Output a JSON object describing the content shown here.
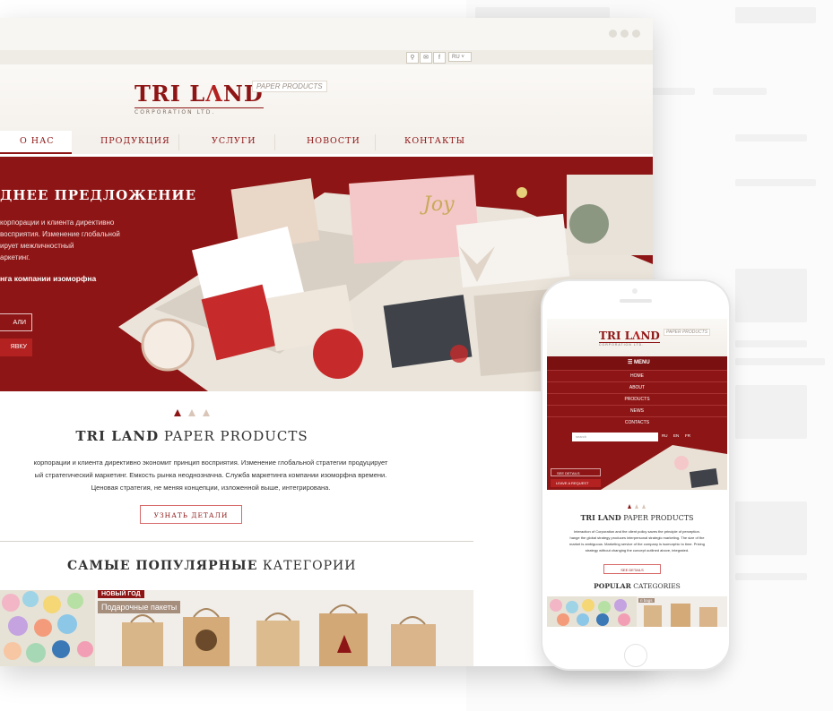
{
  "desktop": {
    "topbar": {
      "lang": "RU"
    },
    "logo": {
      "name_part1": "TRI L",
      "name_part2": "ND",
      "subtitle": "CORPORATION LTD.",
      "tag": "PAPER PRODUCTS"
    },
    "nav": [
      "О НАС",
      "ПРОДУКЦИЯ",
      "УСЛУГИ",
      "НОВОСТИ",
      "КОНТАКТЫ"
    ],
    "hero": {
      "title": "ДНЕЕ ПРЕДЛОЖЕНИЕ",
      "lines": [
        "корпорации и клиента директивно",
        "восприятия. Изменение глобальной",
        "ирует межличностный",
        "аркетинг."
      ],
      "strong": "нга компании изоморфна",
      "btn_details": "АЛИ",
      "btn_request": "ЯВКУ"
    },
    "about": {
      "title_bold": "TRI LAND",
      "title_rest": "PAPER PRODUCTS",
      "lines": [
        "корпорации и клиента директивно экономит принцип восприятия. Изменение глобальной стратегии продуцирует",
        "ый стратегический маркетинг. Емкость рынка неоднозначна. Служба маркетинга компании изоморфна времени.",
        "Ценовая стратегия, не меняя концепции, изложенной выше, интегрирована."
      ],
      "button": "УЗНАТЬ ДЕТАЛИ"
    },
    "popular": {
      "title_bold": "САМЫЕ ПОПУЛЯРНЫЕ",
      "title_rest": "КАТЕГОРИИ"
    },
    "category": {
      "badge": "НОВЫЙ ГОД",
      "label": "Подарочные пакеты"
    }
  },
  "mobile": {
    "logo": {
      "name_part1": "TRI L",
      "name_part2": "ND",
      "subtitle": "CORPORATION LTD.",
      "tag": "PAPER PRODUCTS"
    },
    "menu_title": "MENU",
    "menu_items": [
      "HOME",
      "ABOUT",
      "PRODUCTS",
      "NEWS",
      "CONTACTS"
    ],
    "search_placeholder": "search",
    "langs": [
      "RU",
      "EN",
      "FR"
    ],
    "hero": {
      "btn_details": "SEE DETAILS",
      "btn_request": "LEAVE A REQUEST"
    },
    "about": {
      "title_bold": "TRI LAND",
      "title_rest": "PAPER PRODUCTS",
      "lines": [
        "Interaction of Corporation and the client policy saves the principle of perception.",
        "hange the global strategy produces interpersonal strategic marketing. The size of the",
        "market is ambiguous. Marketing service of the company is isomorphic to time. Pricing",
        "strategy without changing the concept outlined above, integrated."
      ],
      "button": "SEE DETAILS"
    },
    "popular": {
      "title_bold": "POPULAR",
      "title_rest": "CATEGORIES"
    },
    "category_label": "ri bags"
  },
  "colors": {
    "brand_red": "#8e1515",
    "accent_red": "#b32121",
    "cream": "#f3efea"
  }
}
